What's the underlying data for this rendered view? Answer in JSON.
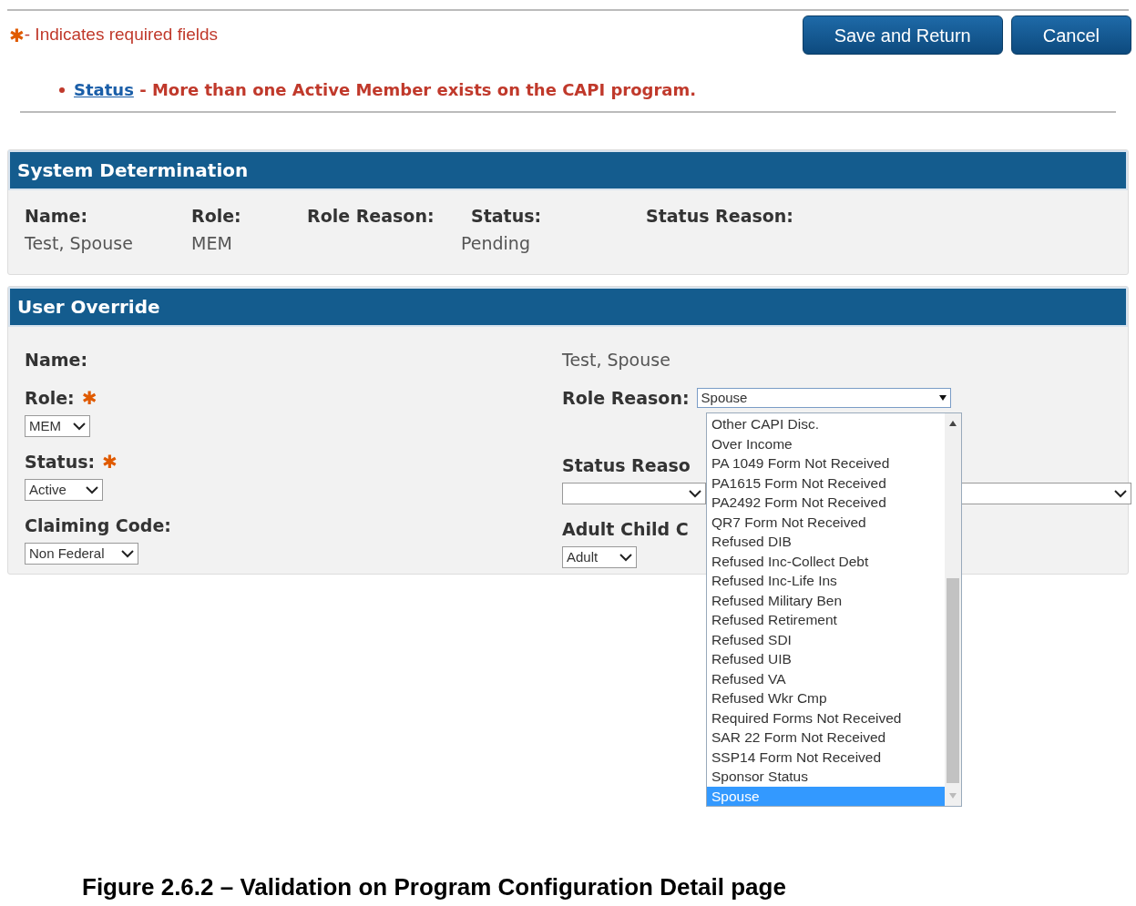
{
  "required_note": {
    "marker": "✱",
    "text": "- Indicates required fields"
  },
  "buttons": [
    "Save and Return",
    "Cancel"
  ],
  "errors": [
    {
      "link": "Status",
      "message": "- More than one Active Member exists on the CAPI program."
    }
  ],
  "system_determination": {
    "title": "System Determination",
    "fields": [
      {
        "label": "Name:",
        "value": "Test, Spouse"
      },
      {
        "label": "Role:",
        "value": "MEM"
      },
      {
        "label": "Role Reason:"
      },
      {
        "label": "Status:",
        "value": "Pending"
      },
      {
        "label": "Status Reason:"
      }
    ]
  },
  "user_override": {
    "title": "User Override",
    "required_marker": "✱",
    "name": {
      "label": "Name:",
      "value": "Test, Spouse"
    },
    "role": {
      "label": "Role:",
      "required": true,
      "value": "MEM"
    },
    "role_reason": {
      "label": "Role Reason:",
      "value": "Spouse",
      "expanded": true,
      "options": [
        {
          "label": "Other CAPI Disc.",
          "selected": false
        },
        {
          "label": "Over Income",
          "selected": false
        },
        {
          "label": "PA 1049 Form Not Received",
          "selected": false
        },
        {
          "label": "PA1615 Form Not Received",
          "selected": false
        },
        {
          "label": "PA2492 Form Not Received",
          "selected": false
        },
        {
          "label": "QR7 Form Not Received",
          "selected": false
        },
        {
          "label": "Refused DIB",
          "selected": false
        },
        {
          "label": "Refused Inc-Collect Debt",
          "selected": false
        },
        {
          "label": "Refused Inc-Life Ins",
          "selected": false
        },
        {
          "label": "Refused Military Ben",
          "selected": false
        },
        {
          "label": "Refused Retirement",
          "selected": false
        },
        {
          "label": "Refused SDI",
          "selected": false
        },
        {
          "label": "Refused UIB",
          "selected": false
        },
        {
          "label": "Refused VA",
          "selected": false
        },
        {
          "label": "Refused Wkr Cmp",
          "selected": false
        },
        {
          "label": "Required Forms Not Received",
          "selected": false
        },
        {
          "label": "SAR 22 Form Not Received",
          "selected": false
        },
        {
          "label": "SSP14 Form Not Received",
          "selected": false
        },
        {
          "label": "Sponsor Status",
          "selected": false
        },
        {
          "label": "Spouse",
          "selected": true
        }
      ]
    },
    "status": {
      "label": "Status:",
      "required": true,
      "value": "Active"
    },
    "status_reason": {
      "label": "Status Reaso"
    },
    "claiming_code": {
      "label": "Claiming Code:",
      "value": "Non Federal"
    },
    "adult_child_code": {
      "label": "Adult Child C",
      "value": "Adult"
    }
  },
  "caption": "Figure 2.6.2 – Validation on Program Configuration Detail page"
}
